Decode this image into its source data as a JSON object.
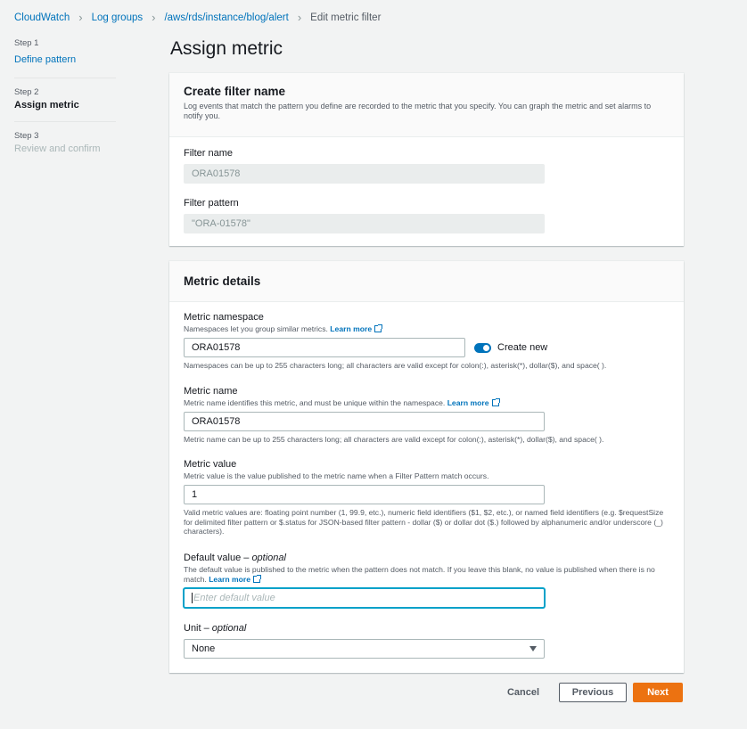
{
  "breadcrumb": {
    "items": [
      "CloudWatch",
      "Log groups",
      "/aws/rds/instance/blog/alert"
    ],
    "current": "Edit metric filter"
  },
  "steps": [
    {
      "num": "Step 1",
      "title": "Define pattern"
    },
    {
      "num": "Step 2",
      "title": "Assign metric"
    },
    {
      "num": "Step 3",
      "title": "Review and confirm"
    }
  ],
  "page_title": "Assign metric",
  "filter_panel": {
    "title": "Create filter name",
    "description": "Log events that match the pattern you define are recorded to the metric that you specify. You can graph the metric and set alarms to notify you.",
    "filter_name_label": "Filter name",
    "filter_name_value": "ORA01578",
    "filter_pattern_label": "Filter pattern",
    "filter_pattern_value": "\"ORA-01578\""
  },
  "metric_panel": {
    "title": "Metric details",
    "namespace": {
      "label": "Metric namespace",
      "desc": "Namespaces let you group similar metrics.",
      "learn_more": "Learn more",
      "value": "ORA01578",
      "toggle_label": "Create new",
      "constraint": "Namespaces can be up to 255 characters long; all characters are valid except for colon(:), asterisk(*), dollar($), and space( )."
    },
    "name": {
      "label": "Metric name",
      "desc": "Metric name identifies this metric, and must be unique within the namespace.",
      "learn_more": "Learn more",
      "value": "ORA01578",
      "constraint": "Metric name can be up to 255 characters long; all characters are valid except for colon(:), asterisk(*), dollar($), and space( )."
    },
    "value": {
      "label": "Metric value",
      "desc": "Metric value is the value published to the metric name when a Filter Pattern match occurs.",
      "value": "1",
      "constraint": "Valid metric values are: floating point number (1, 99.9, etc.), numeric field identifiers ($1, $2, etc.), or named field identifiers (e.g. $requestSize for delimited filter pattern or $.status for JSON-based filter pattern - dollar ($) or dollar dot ($.) followed by alphanumeric and/or underscore (_) characters)."
    },
    "default_value": {
      "label": "Default value – ",
      "label_optional": "optional",
      "desc": "The default value is published to the metric when the pattern does not match. If you leave this blank, no value is published when there is no match.",
      "learn_more": "Learn more",
      "placeholder": "Enter default value"
    },
    "unit": {
      "label": "Unit – ",
      "label_optional": "optional",
      "selected": "None"
    }
  },
  "actions": {
    "cancel": "Cancel",
    "previous": "Previous",
    "next": "Next"
  },
  "colors": {
    "link": "#0073bb",
    "primary_button": "#ec7211",
    "focus": "#00a1c9"
  }
}
